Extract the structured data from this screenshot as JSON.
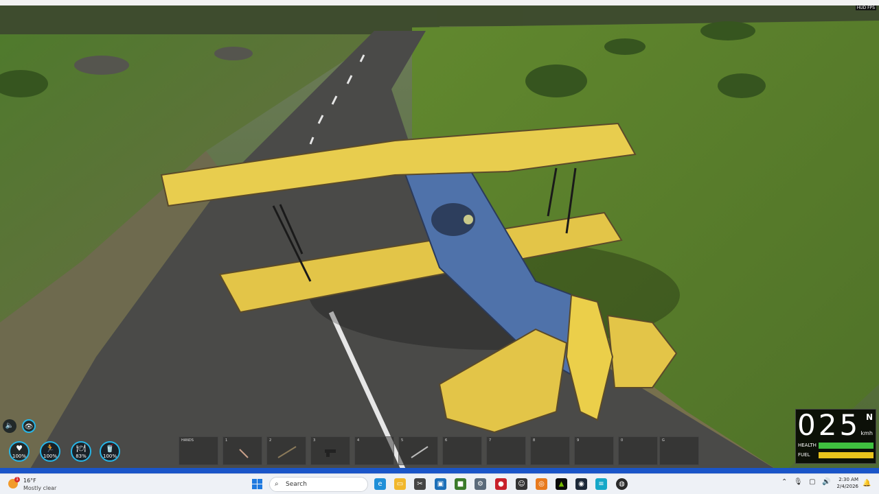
{
  "hud": {
    "audio_icon": "speaker-icon",
    "view_icon": "eye-icon",
    "stats": [
      {
        "name": "health",
        "icon": "♥",
        "value": "100%"
      },
      {
        "name": "stamina",
        "icon": "🏃",
        "value": "100%"
      },
      {
        "name": "hunger",
        "icon": "🍽",
        "value": "83%"
      },
      {
        "name": "thirst",
        "icon": "🥤",
        "value": "100%"
      }
    ],
    "hotbar": {
      "slots": [
        {
          "num": "HANDS",
          "item": ""
        },
        {
          "num": "1",
          "item": "knife"
        },
        {
          "num": "2",
          "item": "rifle"
        },
        {
          "num": "3",
          "item": "pistol"
        },
        {
          "num": "4",
          "item": ""
        },
        {
          "num": "5",
          "item": "spear"
        },
        {
          "num": "6",
          "item": ""
        },
        {
          "num": "7",
          "item": ""
        },
        {
          "num": "8",
          "item": ""
        },
        {
          "num": "9",
          "item": ""
        },
        {
          "num": "0",
          "item": ""
        },
        {
          "num": "G",
          "item": ""
        }
      ]
    },
    "vehicle": {
      "speed": "025",
      "unit": "kmh",
      "heading": "N",
      "health_label": "HEALTH",
      "fuel_label": "FUEL",
      "health_fraction": 1.0,
      "fuel_fraction": 1.0,
      "health_color": "#3fbf3f",
      "fuel_color": "#e8c21c"
    },
    "fps_label": "HUD FPS"
  },
  "taskbar": {
    "weather": {
      "temp": "16°F",
      "condition": "Mostly clear",
      "badge": "1"
    },
    "search_placeholder": "Search",
    "apps": [
      "edge-icon",
      "file-explorer-icon",
      "snipping-tool-icon",
      "photos-icon",
      "minecraft-icon",
      "settings-icon",
      "game-icon",
      "cat-icon",
      "blender-icon",
      "nvidia-icon",
      "steam-icon",
      "notepad-icon",
      "obs-icon"
    ],
    "clock": {
      "time": "2:30 AM",
      "date": "2/4/2026"
    }
  },
  "colors": {
    "hud_accent": "#27b6e8",
    "plane_wing": "#e8cd4e",
    "plane_body": "#5578b0",
    "taskbar_accent": "#1f7ae0"
  }
}
